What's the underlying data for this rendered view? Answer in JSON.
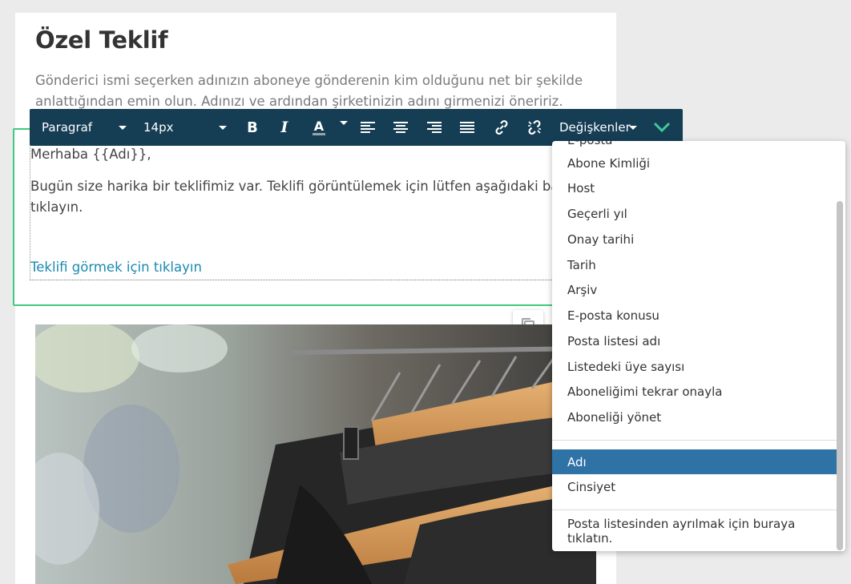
{
  "page": {
    "title": "Özel Teklif",
    "subtitle": "Gönderici ismi seçerken adınızın aboneye gönderenin kim olduğunu net bir şekilde anlattığından emin olun. Adınızı ve ardından şirketinizin adını girmenizi öneririz."
  },
  "editor": {
    "greeting": "Merhaba {{Adı}},",
    "body_line1": "Bugün size harika bir teklifimiz var. Teklifi görüntülemek için lütfen aşağıdaki bağlantıya",
    "body_line2": "tıklayın.",
    "link": "Teklifi görmek için tıklayın"
  },
  "toolbar": {
    "paragraph": "Paragraf",
    "font_size": "14px",
    "bold_icon": "B",
    "italic_icon": "I",
    "color_icon": "A",
    "variables": "Değişkenler",
    "icons": [
      "bold-icon",
      "italic-icon",
      "text-color-icon",
      "align-left-icon",
      "align-center-icon",
      "align-right-icon",
      "justify-icon",
      "link-icon",
      "unlink-icon",
      "confirm-chevron-icon"
    ]
  },
  "dropdown": {
    "items": [
      "E-posta",
      "Abone Kimliği",
      "Host",
      "Geçerli yıl",
      "Onay tarihi",
      "Tarih",
      "Arşiv",
      "E-posta konusu",
      "Posta listesi adı",
      "Listedeki üye sayısı",
      "Aboneliğimi tekrar onayla",
      "Aboneliği yönet"
    ],
    "field_items": [
      "Adı",
      "Cinsiyet"
    ],
    "unsubscribe": "Posta listesinden ayrılmak için buraya tıklatın.",
    "selected": "Adı"
  },
  "colors": {
    "toolbar_bg": "#153d54",
    "accent_green": "#3fcb7b",
    "selected_bg": "#2f72a6",
    "link": "#1a8ab0"
  }
}
